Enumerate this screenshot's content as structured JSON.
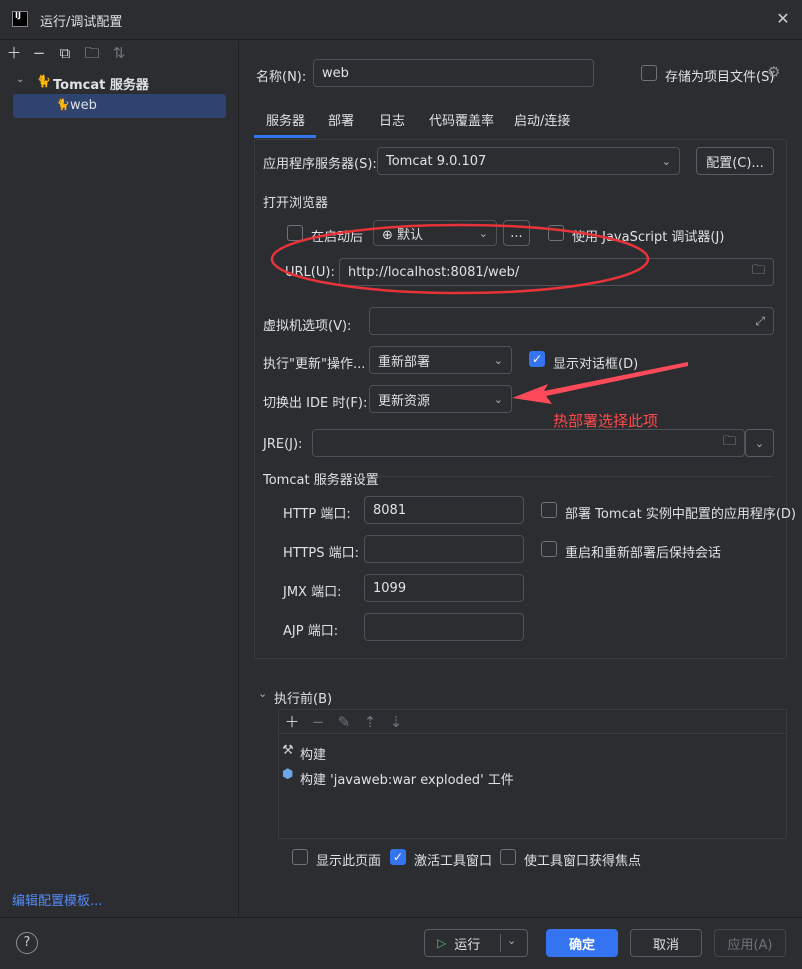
{
  "window": {
    "title": "运行/调试配置"
  },
  "sidebar": {
    "tree": {
      "group": "Tomcat 服务器",
      "child": "web"
    },
    "edit_templates_link": "编辑配置模板..."
  },
  "form": {
    "name_label": "名称(N):",
    "name_value": "web",
    "store_as_project_label": "存储为项目文件(S)"
  },
  "tabs": [
    "服务器",
    "部署",
    "日志",
    "代码覆盖率",
    "启动/连接"
  ],
  "server": {
    "app_server_label": "应用程序服务器(S):",
    "app_server_value": "Tomcat 9.0.107",
    "configure_button": "配置(C)...",
    "open_browser_label": "打开浏览器",
    "after_launch_label": "在启动后",
    "browser_value": "默认",
    "more_button": "...",
    "js_debugger_label": "使用 JavaScript 调试器(J)",
    "url_label": "URL(U):",
    "url_value": "http://localhost:8081/web/",
    "vm_options_label": "虚拟机选项(V):",
    "vm_options_value": "",
    "update_action_label": "执行\"更新\"操作...",
    "update_action_value": "重新部署",
    "show_dialog_label": "显示对话框(D)",
    "frame_deactivation_label": "切换出 IDE 时(F):",
    "frame_deactivation_value": "更新资源",
    "jre_label": "JRE(J):",
    "jre_value": "",
    "tomcat_settings_label": "Tomcat 服务器设置",
    "http_port_label": "HTTP 端口:",
    "http_port_value": "8081",
    "https_port_label": "HTTPS 端口:",
    "https_port_value": "",
    "jmx_port_label": "JMX 端口:",
    "jmx_port_value": "1099",
    "ajp_port_label": "AJP 端口:",
    "ajp_port_value": "",
    "deploy_configured_label": "部署 Tomcat 实例中配置的应用程序(D)",
    "preserve_sessions_label": "重启和重新部署后保持会话"
  },
  "annotation": {
    "text": "热部署选择此项"
  },
  "before_launch": {
    "header": "执行前(B)",
    "items": [
      "构建",
      "构建 'javaweb:war exploded' 工件"
    ],
    "show_page_label": "显示此页面",
    "activate_tool_window_label": "激活工具窗口",
    "focus_tool_window_label": "使工具窗口获得焦点"
  },
  "footer": {
    "help": "?",
    "run_button": "运行",
    "ok_button": "确定",
    "cancel_button": "取消",
    "apply_button": "应用(A)"
  },
  "colors": {
    "accent": "#3574f0",
    "annotation": "#ff4a4a",
    "background": "#2b2d30"
  }
}
